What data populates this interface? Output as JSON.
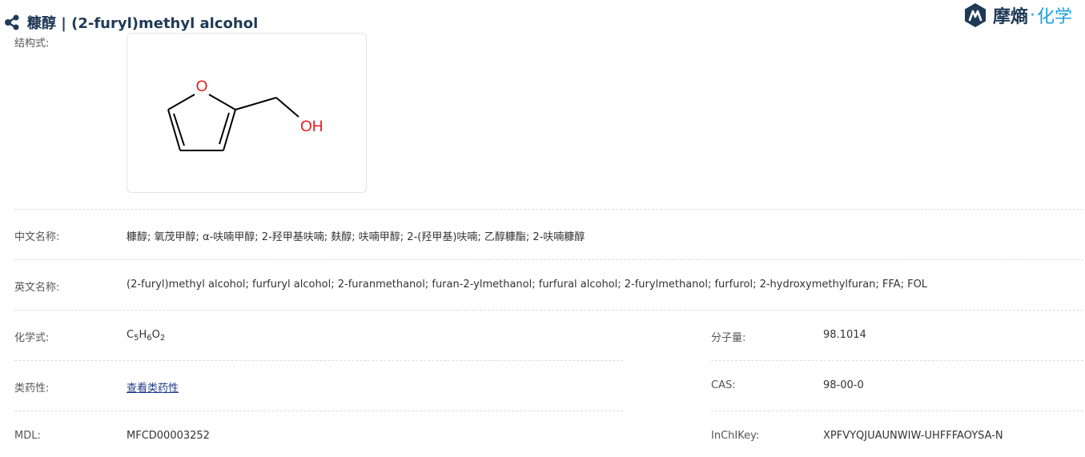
{
  "header": {
    "title": "糠醇 | (2-furyl)methyl alcohol",
    "brand_name_main": "摩熵",
    "brand_separator": "·",
    "brand_name_accent": "化学"
  },
  "structure": {
    "label": "结构式:",
    "atom_o_ring": "O",
    "atom_oh": "OH"
  },
  "fields": {
    "chinese_names": {
      "label": "中文名称:",
      "value": "糠醇; 氧茂甲醇; α-呋喃甲醇; 2-羟甲基呋喃; 麸醇; 呋喃甲醇; 2-(羟甲基)呋喃; 乙醇糠酯; 2-呋喃糠醇"
    },
    "english_names": {
      "label": "英文名称:",
      "value": "(2-furyl)methyl alcohol; furfuryl alcohol; 2-furanmethanol; furan-2-ylmethanol; furfural alcohol; 2-furylmethanol; furfurol; 2-hydroxymethylfuran; FFA; FOL"
    },
    "formula": {
      "label": "化学式:",
      "c": "C",
      "c_n": "5",
      "h": "H",
      "h_n": "6",
      "o": "O",
      "o_n": "2"
    },
    "molecular_weight": {
      "label": "分子量:",
      "value": "98.1014"
    },
    "druglikeness": {
      "label": "类药性:",
      "value": "查看类药性"
    },
    "cas": {
      "label": "CAS:",
      "value": "98-00-0"
    },
    "mdl": {
      "label": "MDL:",
      "value": "MFCD00003252"
    },
    "inchikey": {
      "label": "InChIKey:",
      "value": "XPFVYQJUAUNWIW-UHFFFAOYSA-N"
    }
  },
  "colors": {
    "title": "#1f3a56",
    "brand_accent": "#1aa0dc",
    "oxygen_atom": "#e8191e",
    "link": "#1f3a8a"
  }
}
